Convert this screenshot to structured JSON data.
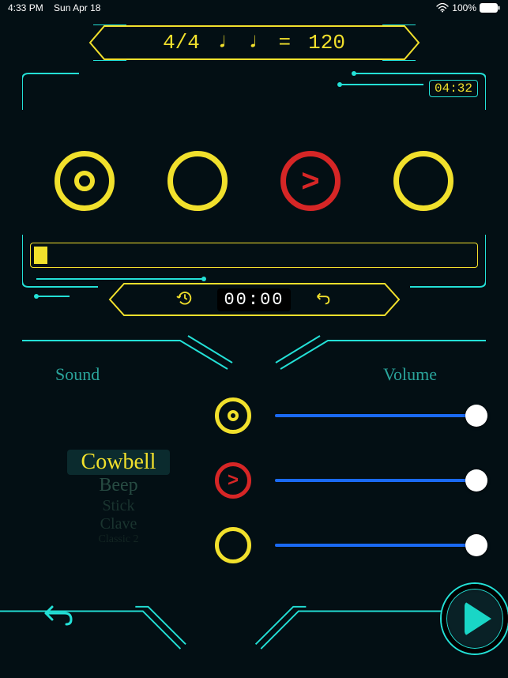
{
  "status": {
    "time": "4:33 PM",
    "date": "Sun Apr 18",
    "battery_pct": "100%"
  },
  "tempo": {
    "time_signature": "4/4",
    "note_glyph_1": "♩",
    "note_glyph_2": "♩",
    "equals": "=",
    "bpm": "120"
  },
  "session_time": "04:32",
  "beats": [
    {
      "variant": "yellow",
      "inner": "ring"
    },
    {
      "variant": "yellow",
      "inner": "none"
    },
    {
      "variant": "red",
      "inner": "accent"
    },
    {
      "variant": "yellow",
      "inner": "none"
    }
  ],
  "progress_pct": 3,
  "timer_display": "00:00",
  "labels": {
    "sound": "Sound",
    "volume": "Volume"
  },
  "sound_picker": {
    "items": [
      "Cowbell",
      "Beep",
      "Stick",
      "Clave",
      "Classic 2"
    ],
    "focus_index": 0
  },
  "volumes": [
    {
      "icon": "accent-ring",
      "pct": 100
    },
    {
      "icon": "accent-gt",
      "pct": 100
    },
    {
      "icon": "plain",
      "pct": 100
    }
  ]
}
